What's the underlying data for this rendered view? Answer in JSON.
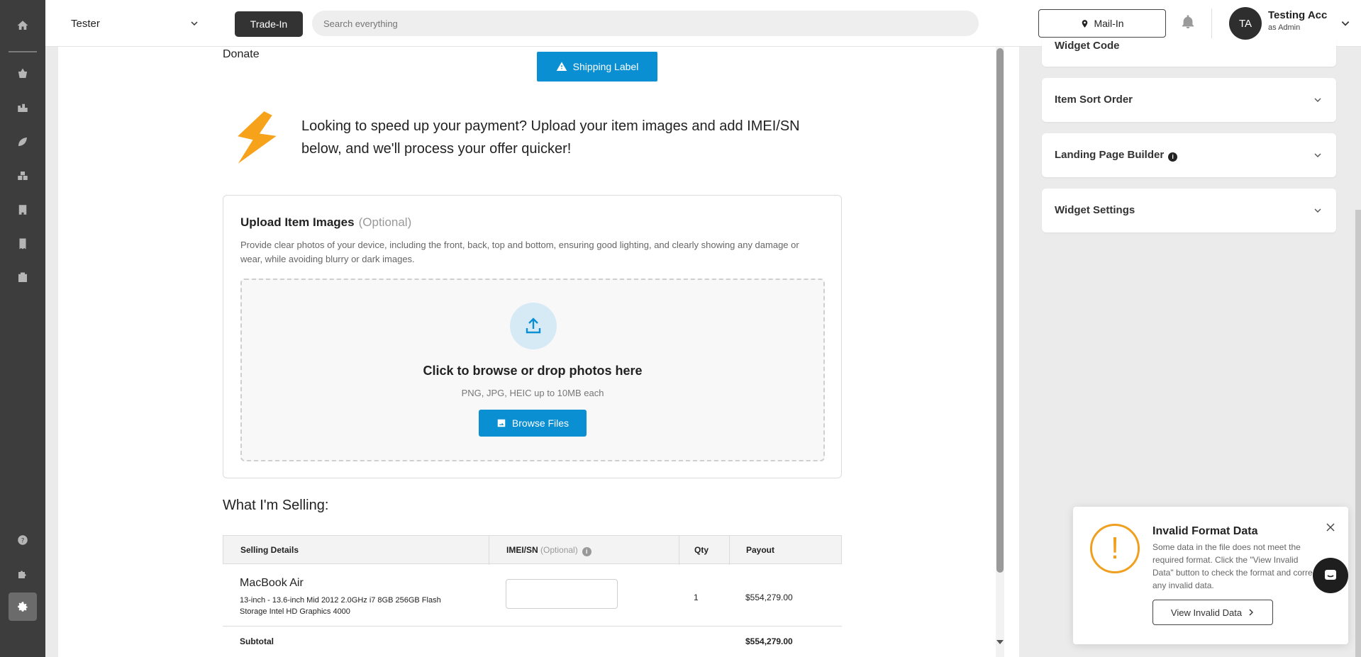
{
  "rail": {
    "icons": [
      "home-icon",
      "basket-icon",
      "warehouse-icon",
      "leaf-icon",
      "boxes-icon",
      "building-icon",
      "receipt-icon",
      "id-card-icon",
      "help-icon",
      "puzzle-icon",
      "settings-icon"
    ]
  },
  "topbar": {
    "store": "Tester",
    "trade_in_label": "Trade-In",
    "search_placeholder": "Search everything",
    "mail_in_label": "Mail-In",
    "avatar_initials": "TA",
    "user_name": "Testing Acc",
    "user_role": "as Admin"
  },
  "main": {
    "donate_label": "Donate",
    "shipping_label_button": "Shipping Label",
    "speed_text": "Looking to speed up your payment? Upload your item images and add IMEI/SN below, and we'll process your offer quicker!",
    "upload": {
      "title": "Upload Item Images",
      "optional": "(Optional)",
      "description": "Provide clear photos of your device, including the front, back, top and bottom, ensuring good lighting, and clearly showing any damage or wear, while avoiding blurry or dark images.",
      "drop_title": "Click to browse or drop photos here",
      "drop_sub": "PNG, JPG, HEIC up to 10MB each",
      "browse_label": "Browse Files"
    },
    "selling_title": "What I'm Selling:",
    "table": {
      "headers": {
        "details": "Selling Details",
        "imei": "IMEI/SN",
        "imei_optional": "(Optional)",
        "qty": "Qty",
        "payout": "Payout"
      },
      "rows": [
        {
          "name": "MacBook Air",
          "spec": "13-inch - 13.6-inch Mid 2012 2.0GHz i7 8GB 256GB Flash Storage Intel HD Graphics 4000",
          "qty": "1",
          "payout": "$554,279.00"
        }
      ],
      "subtotal_label": "Subtotal",
      "subtotal_value": "$554,279.00"
    }
  },
  "right_panel": {
    "widget_code_label": "Widget Code",
    "item_sort_label": "Item Sort Order",
    "landing_page_label": "Landing Page Builder",
    "widget_settings_label": "Widget Settings"
  },
  "toast": {
    "title": "Invalid Format Data",
    "body": "Some data in the file does not meet the required format. Click the \"View Invalid Data\" button to check the format and correct any invalid data.",
    "button": "View Invalid Data"
  },
  "colors": {
    "accent": "#0b8fd3",
    "rail": "#3d3d3d",
    "warning": "#f0a020",
    "bolt": "#f7a21b"
  }
}
